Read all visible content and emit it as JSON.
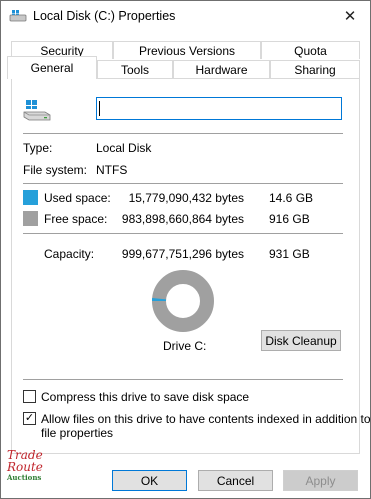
{
  "window": {
    "title": "Local Disk (C:) Properties",
    "close_glyph": "✕"
  },
  "tabs_row1": [
    {
      "label": "Security"
    },
    {
      "label": "Previous Versions"
    },
    {
      "label": "Quota"
    }
  ],
  "tabs_row2": [
    {
      "label": "General",
      "active": true
    },
    {
      "label": "Tools"
    },
    {
      "label": "Hardware"
    },
    {
      "label": "Sharing"
    }
  ],
  "general": {
    "name_value": "",
    "type_label": "Type:",
    "type_value": "Local Disk",
    "fs_label": "File system:",
    "fs_value": "NTFS",
    "used_label": "Used space:",
    "used_bytes": "15,779,090,432 bytes",
    "used_gb": "14.6 GB",
    "free_label": "Free space:",
    "free_bytes": "983,898,660,864 bytes",
    "free_gb": "916 GB",
    "capacity_label": "Capacity:",
    "capacity_bytes": "999,677,751,296 bytes",
    "capacity_gb": "931 GB",
    "drive_label": "Drive C:",
    "cleanup_button": "Disk Cleanup",
    "used_fraction": 0.0158,
    "used_color": "#26a0da",
    "free_color": "#a0a0a0"
  },
  "options": {
    "compress_label": "Compress this drive to save disk space",
    "compress_checked": false,
    "index_label_1": "Allow files on this drive to have contents indexed in addition to",
    "index_label_2": "file properties",
    "index_checked": true,
    "check_glyph": "✓"
  },
  "buttons": {
    "ok": "OK",
    "cancel": "Cancel",
    "apply": "Apply"
  },
  "watermark": {
    "line1": "Trade",
    "line2": "Route",
    "line3": "Auctions"
  }
}
